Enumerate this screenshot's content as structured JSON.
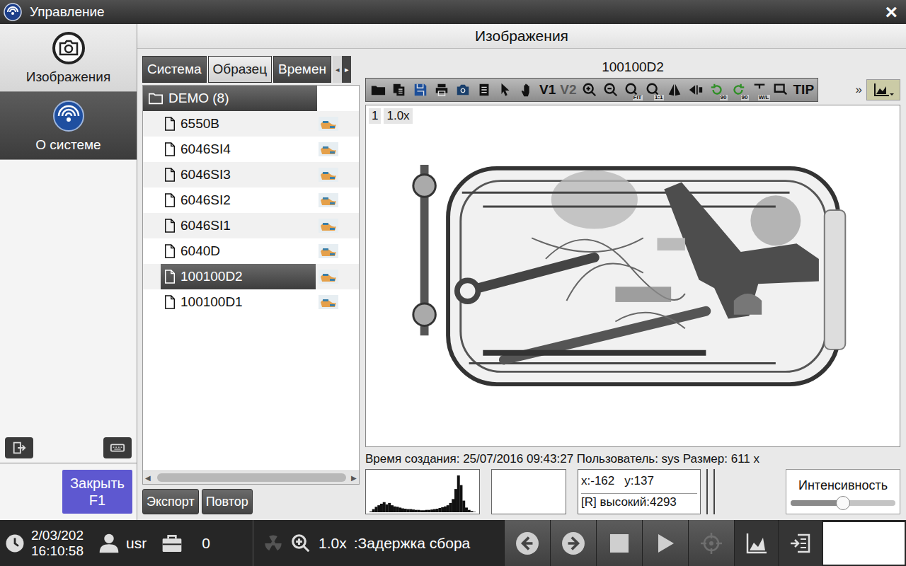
{
  "window": {
    "title": "Управление",
    "close": "×"
  },
  "sidebar": {
    "items": [
      {
        "label": "Изображения",
        "selected": true
      },
      {
        "label": "О системе",
        "selected": false
      }
    ],
    "close_button": {
      "label": "Закрыть",
      "key": "F1"
    }
  },
  "page": {
    "title": "Изображения"
  },
  "browser": {
    "tabs": [
      {
        "label": "Система",
        "selected": false
      },
      {
        "label": "Образец",
        "selected": true
      },
      {
        "label": "Времен",
        "selected": false
      }
    ],
    "tab_arrows": [
      "◂",
      "▸"
    ],
    "folder": {
      "label": "DEMO (8)",
      "expanded": true,
      "highlighted": true
    },
    "files": [
      {
        "name": "6550B",
        "selected": false
      },
      {
        "name": "6046SI4",
        "selected": false
      },
      {
        "name": "6046SI3",
        "selected": false
      },
      {
        "name": "6046SI2",
        "selected": false
      },
      {
        "name": "6046SI1",
        "selected": false
      },
      {
        "name": "6040D",
        "selected": false
      },
      {
        "name": "100100D2",
        "selected": true
      },
      {
        "name": "100100D1",
        "selected": false
      }
    ],
    "scroll_arrows": [
      "◀",
      "▶"
    ],
    "buttons": [
      "Экспорт",
      "Повтор"
    ]
  },
  "viewer": {
    "title": "100100D2",
    "toolbar": [
      {
        "kind": "icon",
        "disabled": false
      },
      {
        "kind": "icon",
        "disabled": false
      },
      {
        "kind": "icon",
        "disabled": false
      },
      {
        "kind": "icon",
        "disabled": false
      },
      {
        "kind": "icon",
        "disabled": false
      },
      {
        "kind": "icon",
        "disabled": false
      },
      {
        "kind": "icon",
        "disabled": false
      },
      {
        "kind": "icon",
        "disabled": false
      },
      {
        "kind": "text",
        "label": "V1",
        "disabled": false
      },
      {
        "kind": "text",
        "label": "V2",
        "disabled": true
      },
      {
        "kind": "icon",
        "disabled": false
      },
      {
        "kind": "icon",
        "disabled": false
      },
      {
        "kind": "icon",
        "label": "FIT",
        "disabled": false
      },
      {
        "kind": "icon",
        "label": "1:1",
        "disabled": false
      },
      {
        "kind": "icon",
        "disabled": false
      },
      {
        "kind": "icon",
        "disabled": false
      },
      {
        "kind": "icon",
        "label": "90",
        "disabled": false
      },
      {
        "kind": "icon",
        "label": "90",
        "disabled": false
      },
      {
        "kind": "icon",
        "label": "W/L",
        "disabled": false
      },
      {
        "kind": "icon",
        "disabled": false
      },
      {
        "kind": "text",
        "label": "TIP",
        "disabled": false
      }
    ],
    "more": "»",
    "zoom_index": "1",
    "zoom": "1.0x",
    "info": "Время создания: 25/07/2016 09:43:27 Пользователь: sys Размер: 611 x",
    "histogram": [
      2,
      8,
      14,
      18,
      22,
      26,
      20,
      24,
      18,
      15,
      14,
      12,
      10,
      9,
      8,
      8,
      7,
      6,
      6,
      5,
      5,
      6,
      6,
      7,
      8,
      9,
      11,
      13,
      15,
      18,
      24,
      34,
      60,
      95,
      70,
      30,
      12,
      6,
      3,
      1
    ],
    "coords": {
      "x": "x:-162",
      "y": "y:137"
    },
    "reading": "[R] высокий:4293",
    "intensity": {
      "label": "Интенсивность",
      "level": 0.5
    }
  },
  "status_bar": {
    "date": "2/03/202",
    "time": "16:10:58",
    "user": "usr",
    "count": "0",
    "radiation_on": false,
    "zoom": "1.0x",
    "delay": ":Задержка сбора",
    "controls": [
      {
        "disabled": false
      },
      {
        "disabled": false
      },
      {
        "disabled": false
      },
      {
        "disabled": false
      },
      {
        "disabled": true
      }
    ]
  }
}
